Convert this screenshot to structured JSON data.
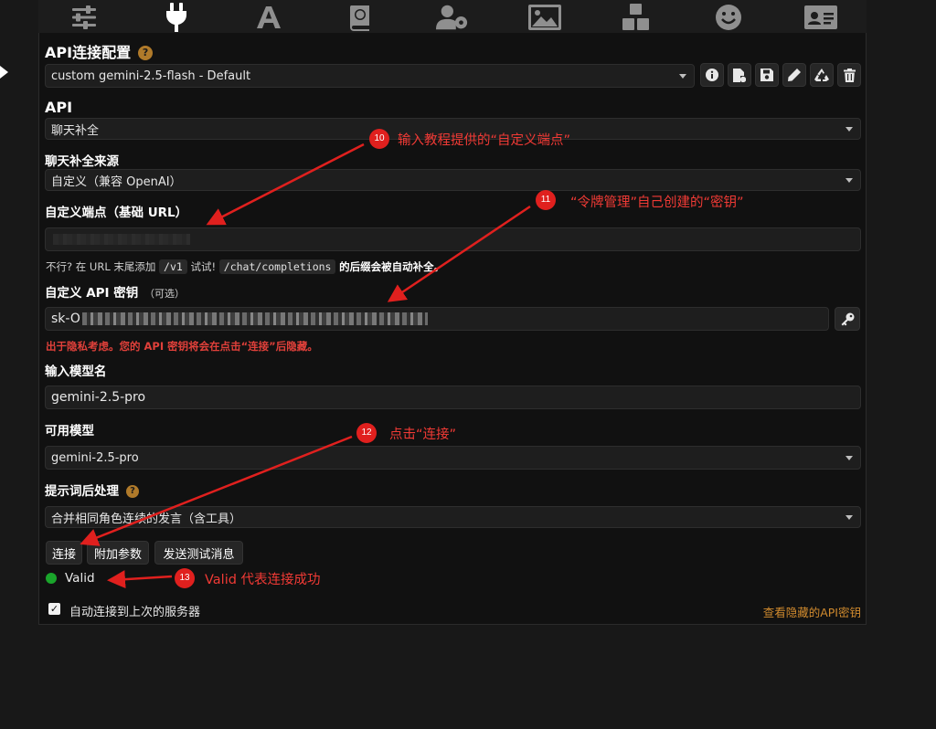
{
  "topbar": {
    "icons": [
      "sliders-icon",
      "plug-icon",
      "font-icon",
      "book-icon",
      "user-gear-icon",
      "image-icon",
      "cubes-icon",
      "smile-icon",
      "id-card-icon"
    ]
  },
  "api_config": {
    "title": "API连接配置",
    "help": "?",
    "preset_value": "custom gemini-2.5-flash - Default"
  },
  "api": {
    "label": "API",
    "value": "聊天补全"
  },
  "source": {
    "label": "聊天补全来源",
    "value": "自定义（兼容 OpenAI）"
  },
  "endpoint": {
    "label": "自定义端点（基础 URL）",
    "hint_prefix": "不行? 在 URL 末尾添加",
    "hint_code1": "/v1",
    "hint_mid": "试试!",
    "hint_code2": "/chat/completions",
    "hint_suffix": "的后缀会被自动补全。"
  },
  "api_key": {
    "label": "自定义 API 密钥",
    "optional": "（可选）",
    "value_prefix": "sk-O",
    "warning": "出于隐私考虑。您的 API 密钥将会在点击“连接”后隐藏。"
  },
  "model_name": {
    "label": "输入模型名",
    "value": "gemini-2.5-pro"
  },
  "available_models": {
    "label": "可用模型",
    "value": "gemini-2.5-pro"
  },
  "post_processing": {
    "label": "提示词后处理",
    "help": "?",
    "value": "合并相同角色连续的发言（含工具）"
  },
  "buttons": {
    "connect": "连接",
    "extra_params": "附加参数",
    "send_test": "发送测试消息"
  },
  "status": {
    "text": "Valid",
    "color": "#1aa52b"
  },
  "auto_connect": {
    "label": "自动连接到上次的服务器",
    "checked": true
  },
  "view_hidden_keys": "查看隐藏的API密钥",
  "annotations": [
    {
      "badge": "10",
      "text": "输入教程提供的“自定义端点”"
    },
    {
      "badge": "11",
      "text": "“令牌管理”自己创建的“密钥”"
    },
    {
      "badge": "12",
      "text": "点击“连接”"
    },
    {
      "badge": "13",
      "text": "Valid 代表连接成功"
    }
  ],
  "colors": {
    "annotation_red": "#e0201e",
    "link_orange": "#d08a2e",
    "help_badge": "#b07a2a"
  }
}
